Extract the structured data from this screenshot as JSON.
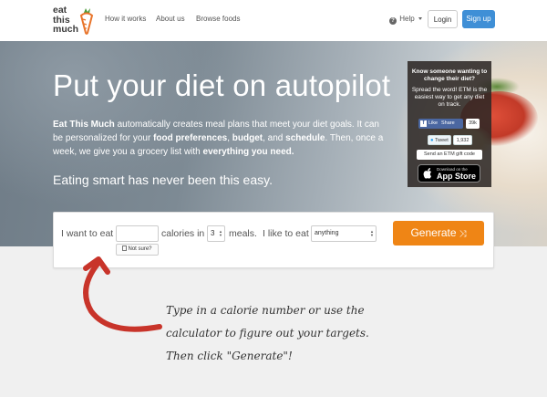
{
  "logo": {
    "line1": "eat",
    "line2": "this",
    "line3": "much"
  },
  "nav": {
    "links": [
      "How it works",
      "About us",
      "Browse foods"
    ],
    "help": "Help",
    "login": "Login",
    "signup": "Sign up"
  },
  "hero": {
    "title": "Put your diet on autopilot",
    "desc_brand": "Eat This Much",
    "desc_1": " automatically creates meal plans that meet your diet goals. It can be personalized for your ",
    "desc_b1": "food preferences",
    "desc_2": ", ",
    "desc_b2": "budget",
    "desc_3": ", and ",
    "desc_b3": "schedule",
    "desc_4": ". Then, once a week, we give you a grocery list with ",
    "desc_b4": "everything you need.",
    "subtitle": "Eating smart has never been this easy."
  },
  "share": {
    "question": "Know someone wanting to change their diet?",
    "spread": "Spread the word! ETM is the easiest way to get any diet on track.",
    "fb_like": "Like",
    "fb_share": "Share",
    "fb_count": "39k",
    "tweet": "Tweet",
    "tweet_count": "1,932",
    "gift": "Send an ETM gift code",
    "appstore_small": "Download on the",
    "appstore_big": "App Store"
  },
  "form": {
    "want_label": "I want to eat",
    "calories_value": "",
    "calories_label": "calories in",
    "meals_value": "3",
    "meals_label": "meals.",
    "like_label": "I like to eat",
    "diet_value": "anything",
    "not_sure": "Not sure?",
    "generate": "Generate"
  },
  "annotation": {
    "line1": "Type in a calorie number or use the",
    "line2": "calculator to figure out your targets.",
    "line3": "Then click \"Generate\"!"
  },
  "colors": {
    "brand_orange": "#ef8515",
    "signup_blue": "#3f8fd6",
    "arrow_red": "#c8342a"
  }
}
